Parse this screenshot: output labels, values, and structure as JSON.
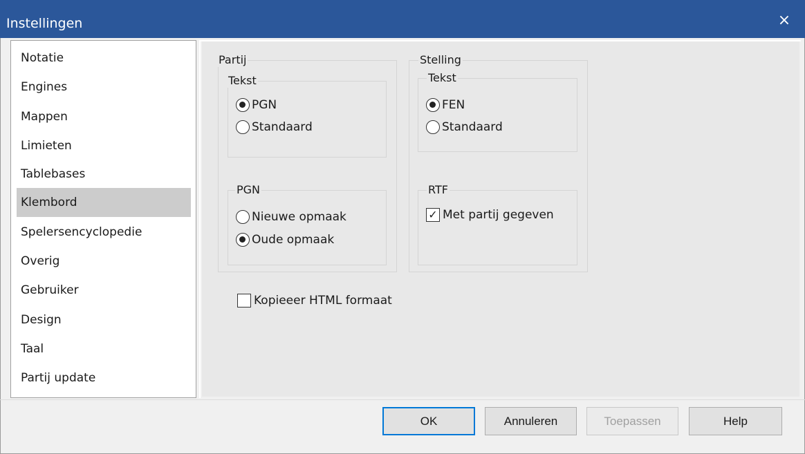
{
  "window": {
    "title": "Instellingen",
    "close_glyph": "×"
  },
  "sidebar": {
    "items": [
      {
        "label": "Notatie",
        "selected": false
      },
      {
        "label": "Engines",
        "selected": false
      },
      {
        "label": "Mappen",
        "selected": false
      },
      {
        "label": "Limieten",
        "selected": false
      },
      {
        "label": "Tablebases",
        "selected": false
      },
      {
        "label": "Klembord",
        "selected": true
      },
      {
        "label": "Spelersencyclopedie",
        "selected": false
      },
      {
        "label": "Overig",
        "selected": false
      },
      {
        "label": "Gebruiker",
        "selected": false
      },
      {
        "label": "Design",
        "selected": false
      },
      {
        "label": "Taal",
        "selected": false
      },
      {
        "label": "Partij update",
        "selected": false
      }
    ]
  },
  "partij": {
    "label": "Partij",
    "tekst": {
      "label": "Tekst",
      "options": [
        {
          "label": "PGN",
          "checked": true
        },
        {
          "label": "Standaard",
          "checked": false
        }
      ]
    },
    "pgn": {
      "label": "PGN",
      "options": [
        {
          "label": "Nieuwe opmaak",
          "checked": false
        },
        {
          "label": "Oude opmaak",
          "checked": true
        }
      ]
    }
  },
  "stelling": {
    "label": "Stelling",
    "tekst": {
      "label": "Tekst",
      "options": [
        {
          "label": "FEN",
          "checked": true
        },
        {
          "label": "Standaard",
          "checked": false
        }
      ]
    },
    "rtf": {
      "label": "RTF",
      "checkbox": {
        "label": "Met partij gegeven",
        "checked": true
      }
    }
  },
  "html_checkbox": {
    "label": "Kopieeer HTML formaat",
    "checked": false
  },
  "buttons": {
    "ok": "OK",
    "cancel": "Annuleren",
    "apply": "Toepassen",
    "help": "Help"
  }
}
